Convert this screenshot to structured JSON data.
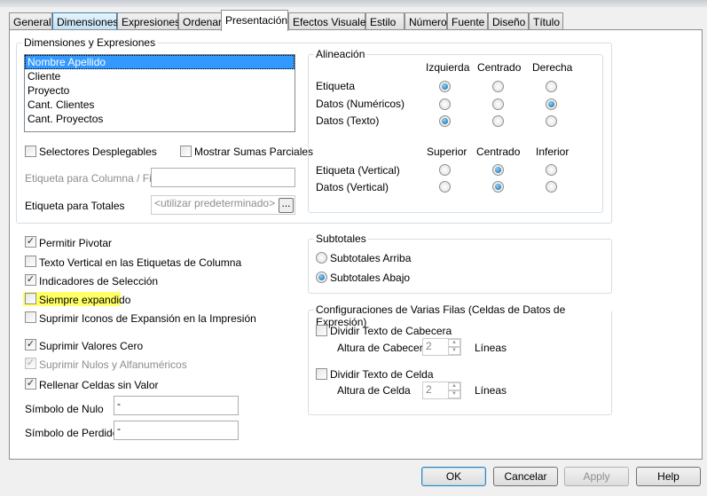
{
  "tabs": [
    "General",
    "Dimensiones",
    "Expresiones",
    "Ordenar",
    "Presentación",
    "Efectos Visuales",
    "Estilo",
    "Número",
    "Fuente",
    "Diseño",
    "Título"
  ],
  "dims": {
    "title": "Dimensiones y Expresiones",
    "items": [
      "Nombre Apellido",
      "Cliente",
      "Proyecto",
      "Cant. Clientes",
      "Cant. Proyectos"
    ],
    "selectores": "Selectores Desplegables",
    "sumas": "Mostrar Sumas Parciales",
    "etiqueta_col": "Etiqueta para Columna / Fila",
    "etiqueta_tot": "Etiqueta para Totales",
    "tot_value": "<utilizar predeterminado>",
    "browse": "..."
  },
  "align": {
    "title": "Alineación",
    "cols": [
      "Izquierda",
      "Centrado",
      "Derecha"
    ],
    "rows": [
      "Etiqueta",
      "Datos (Numéricos)",
      "Datos (Texto)"
    ],
    "vcols": [
      "Superior",
      "Centrado",
      "Inferior"
    ],
    "vrows": [
      "Etiqueta (Vertical)",
      "Datos (Vertical)"
    ]
  },
  "options": [
    "Permitir Pivotar",
    "Texto Vertical en las Etiquetas de Columna",
    "Indicadores de Selección",
    "Siempre expandido",
    "Suprimir Iconos de Expansión en la Impresión",
    "Suprimir Valores Cero",
    "Suprimir Nulos y Alfanuméricos",
    "Rellenar Celdas sin Valor"
  ],
  "nulo": {
    "label": "Símbolo de Nulo",
    "value": "-"
  },
  "perdido": {
    "label": "Símbolo de Perdido",
    "value": "-"
  },
  "subtot": {
    "title": "Subtotales",
    "arriba": "Subtotales Arriba",
    "abajo": "Subtotales Abajo"
  },
  "multi": {
    "title": "Configuraciones de Varias Filas (Celdas de Datos de Expresión)",
    "cab": "Dividir Texto de Cabecera",
    "alt_cab": "Altura de Cabecera",
    "cel": "Dividir Texto de Celda",
    "alt_cel": "Altura de Celda",
    "val": "2",
    "lineas": "Líneas"
  },
  "buttons": {
    "ok": "OK",
    "cancel": "Cancelar",
    "apply": "Apply",
    "help": "Help"
  },
  "check": "✓"
}
